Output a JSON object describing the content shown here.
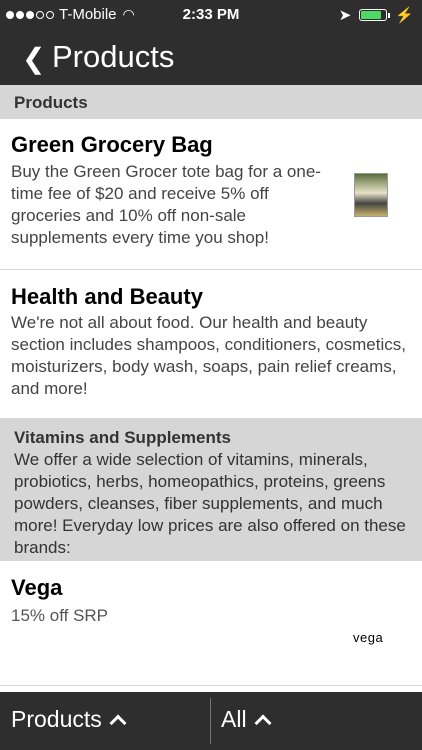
{
  "status_bar": {
    "carrier": "T-Mobile",
    "time": "2:33 PM",
    "signal_bars_filled": 3,
    "signal_bars_total": 5,
    "battery_level": 0.8,
    "battery_color": "#4cd964"
  },
  "nav": {
    "title": "Products"
  },
  "section_header": "Products",
  "products": [
    {
      "title": "Green Grocery Bag",
      "description": "Buy the Green Grocer tote bag for a one-time fee of $20 and receive 5% off groceries and 10% off non-sale supplements every time you shop!"
    },
    {
      "title": "Health and Beauty",
      "description": "We're not all about food. Our health and beauty section includes shampoos, conditioners, cosmetics, moisturizers, body wash, soaps, pain relief creams, and more!"
    }
  ],
  "vitamins": {
    "title": "Vitamins and Supplements",
    "description": "We offer a wide selection of vitamins, minerals, probiotics, herbs, homeopathics, proteins, greens powders, cleanses, fiber supplements, and much more! Everyday low prices are also offered on these brands:"
  },
  "brands": [
    {
      "title": "Vega",
      "subtitle": "15% off SRP",
      "logo_text": "vega"
    }
  ],
  "tab_bar": {
    "left_label": "Products",
    "right_label": "All"
  },
  "colors": {
    "bar_background": "#2e2e2e",
    "section_background": "#d6d6d6"
  }
}
